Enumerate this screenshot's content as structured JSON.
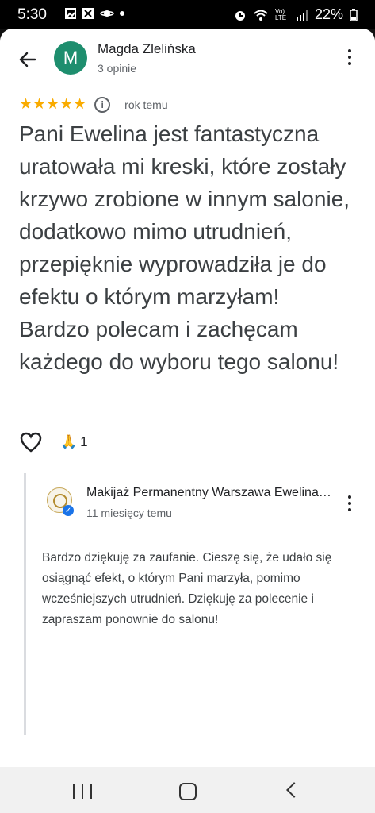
{
  "status_bar": {
    "time": "5:30",
    "battery": "22%",
    "network": "Vo) LTE"
  },
  "reviewer": {
    "avatar_letter": "M",
    "name": "Magda Zlelińska",
    "reviews": "3 opinie"
  },
  "rating": {
    "stars": "★★★★★",
    "time": "rok temu"
  },
  "review_text": "Pani Ewelina jest fantastyczna uratowała mi kreski, które zostały krzywo zrobione w innym salonie, dodatkowo mimo utrudnień, przepięknie wyprowadziła je do efektu o którym marzyłam! Bardzo polecam i zachęcam każdego do wyboru tego salonu!",
  "reactions": {
    "emoji": "🙏",
    "count": "1"
  },
  "owner_reply": {
    "name": "Makijaż Permanentny Warszawa Ewelina Zawadzka",
    "time": "11 miesięcy temu",
    "text": "Bardzo dziękuję za zaufanie. Cieszę się, że udało się osiągnąć efekt, o którym Pani marzyła, pomimo wcześniejszych utrudnień. Dziękuję za polecenie i zapraszam ponownie do salonu!"
  },
  "colors": {
    "avatar_bg": "#1e8e6e",
    "star": "#f9ab00",
    "verified": "#1a73e8"
  }
}
